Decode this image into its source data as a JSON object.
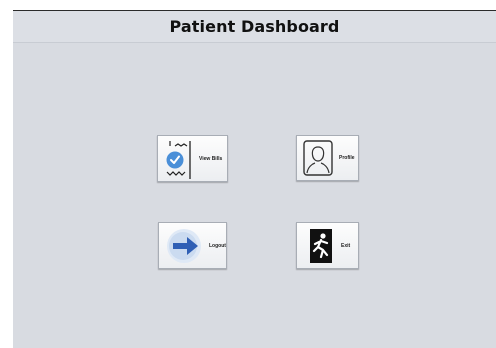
{
  "header": {
    "title": "Patient Dashboard"
  },
  "tiles": [
    {
      "label": "View Bills",
      "icon": "receipt-check-icon"
    },
    {
      "label": "Profile",
      "icon": "profile-icon"
    },
    {
      "label": "Logout",
      "icon": "arrow-right-icon"
    },
    {
      "label": "Exit",
      "icon": "exit-runner-icon"
    }
  ],
  "colors": {
    "background": "#d8dbe1",
    "accent_blue": "#4a8fd8",
    "arrow_blue": "#2f5fb5",
    "exit_icon": "#111111"
  }
}
